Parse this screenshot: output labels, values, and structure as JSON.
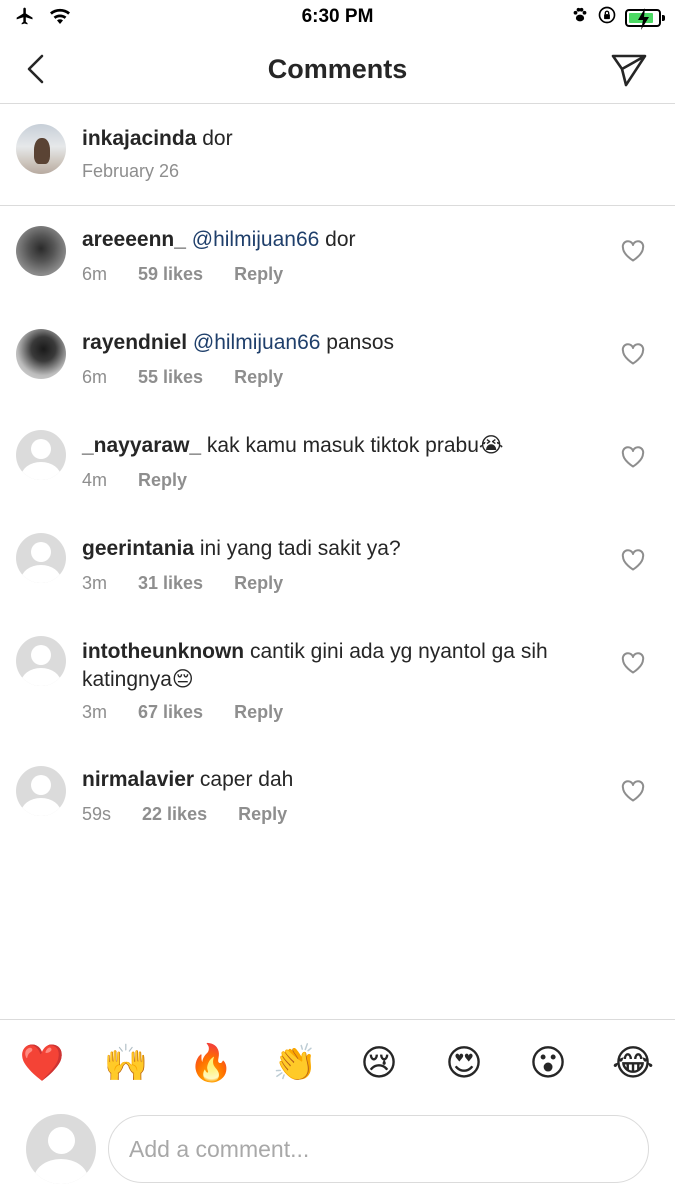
{
  "status_bar": {
    "time": "6:30 PM"
  },
  "header": {
    "title": "Comments"
  },
  "caption": {
    "username": "inkajacinda",
    "text": " dor",
    "date": "February 26"
  },
  "comments": [
    {
      "username": "areeeenn_",
      "mention": "@hilmijuan66",
      "text": " dor",
      "time": "6m",
      "likes": "59 likes",
      "reply": "Reply"
    },
    {
      "username": "rayendniel",
      "mention": "@hilmijuan66",
      "text": " pansos",
      "time": "6m",
      "likes": "55 likes",
      "reply": "Reply"
    },
    {
      "username": "_nayyaraw_",
      "mention": "",
      "text": " kak kamu masuk tiktok prabu😭",
      "time": "4m",
      "likes": "",
      "reply": "Reply"
    },
    {
      "username": "geerintania",
      "mention": "",
      "text": " ini yang tadi sakit ya?",
      "time": "3m",
      "likes": "31 likes",
      "reply": "Reply"
    },
    {
      "username": "intotheunknown",
      "mention": "",
      "text": " cantik gini ada yg nyantol ga sih katingnya😔",
      "time": "3m",
      "likes": "67 likes",
      "reply": "Reply"
    },
    {
      "username": "nirmalavier",
      "mention": "",
      "text": " caper dah",
      "time": "59s",
      "likes": "22 likes",
      "reply": "Reply"
    }
  ],
  "emoji_bar": [
    "❤️",
    "🙌",
    "🔥",
    "👏",
    "😢",
    "😍",
    "😮",
    "😂"
  ],
  "composer": {
    "placeholder": "Add a comment..."
  },
  "colors": {
    "mention": "#1f3f6b",
    "secondary_text": "#8e8e8e",
    "divider": "#dbdbdb",
    "battery": "#4cd964"
  },
  "battery_level": 0.85
}
